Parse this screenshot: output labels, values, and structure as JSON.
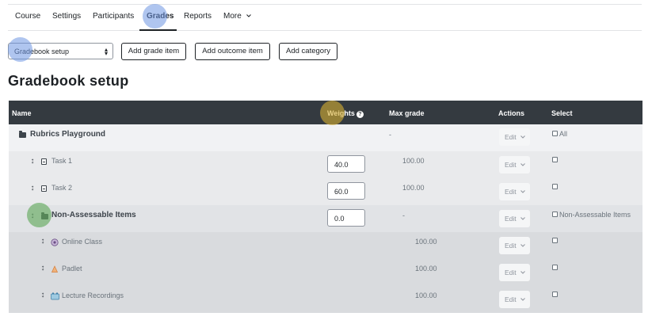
{
  "nav": {
    "course": "Course",
    "settings": "Settings",
    "participants": "Participants",
    "grades": "Grades",
    "reports": "Reports",
    "more": "More"
  },
  "toolbar": {
    "select_value": "Gradebook setup",
    "add_grade_item": "Add grade item",
    "add_outcome_item": "Add outcome item",
    "add_category": "Add category"
  },
  "page_title": "Gradebook setup",
  "table": {
    "headers": {
      "name": "Name",
      "weights": "Weights",
      "max_grade": "Max grade",
      "actions": "Actions",
      "select": "Select"
    },
    "rows": [
      {
        "name": "Rubrics Playground",
        "weight": "",
        "max_grade": "-",
        "edit": "Edit",
        "select": "All"
      },
      {
        "name": "Task 1",
        "weight": "40.0",
        "max_grade": "100.00",
        "edit": "Edit",
        "select": ""
      },
      {
        "name": "Task 2",
        "weight": "60.0",
        "max_grade": "100.00",
        "edit": "Edit",
        "select": ""
      },
      {
        "name": "Non-Assessable Items",
        "weight": "0.0",
        "max_grade": "-",
        "edit": "Edit",
        "select": "Non-Assessable Items"
      },
      {
        "name": "Online Class",
        "weight": "",
        "max_grade": "100.00",
        "edit": "Edit",
        "select": ""
      },
      {
        "name": "Padlet",
        "weight": "",
        "max_grade": "100.00",
        "edit": "Edit",
        "select": ""
      },
      {
        "name": "Lecture Recordings",
        "weight": "",
        "max_grade": "100.00",
        "edit": "Edit",
        "select": ""
      }
    ]
  },
  "icons": {
    "folder": "folder-icon",
    "move": "move-icon",
    "grade_item": "grade-item-icon",
    "online_class": "online-class-icon",
    "padlet": "padlet-icon",
    "lecture_recordings": "lecture-recordings-icon",
    "chevron": "chevron-down-icon",
    "help": "help-icon"
  },
  "colors": {
    "header_bg": "#343a40",
    "highlight_blue": "#7b9fe0",
    "highlight_yellow": "#d9b53c",
    "highlight_green": "#6cae6b"
  }
}
